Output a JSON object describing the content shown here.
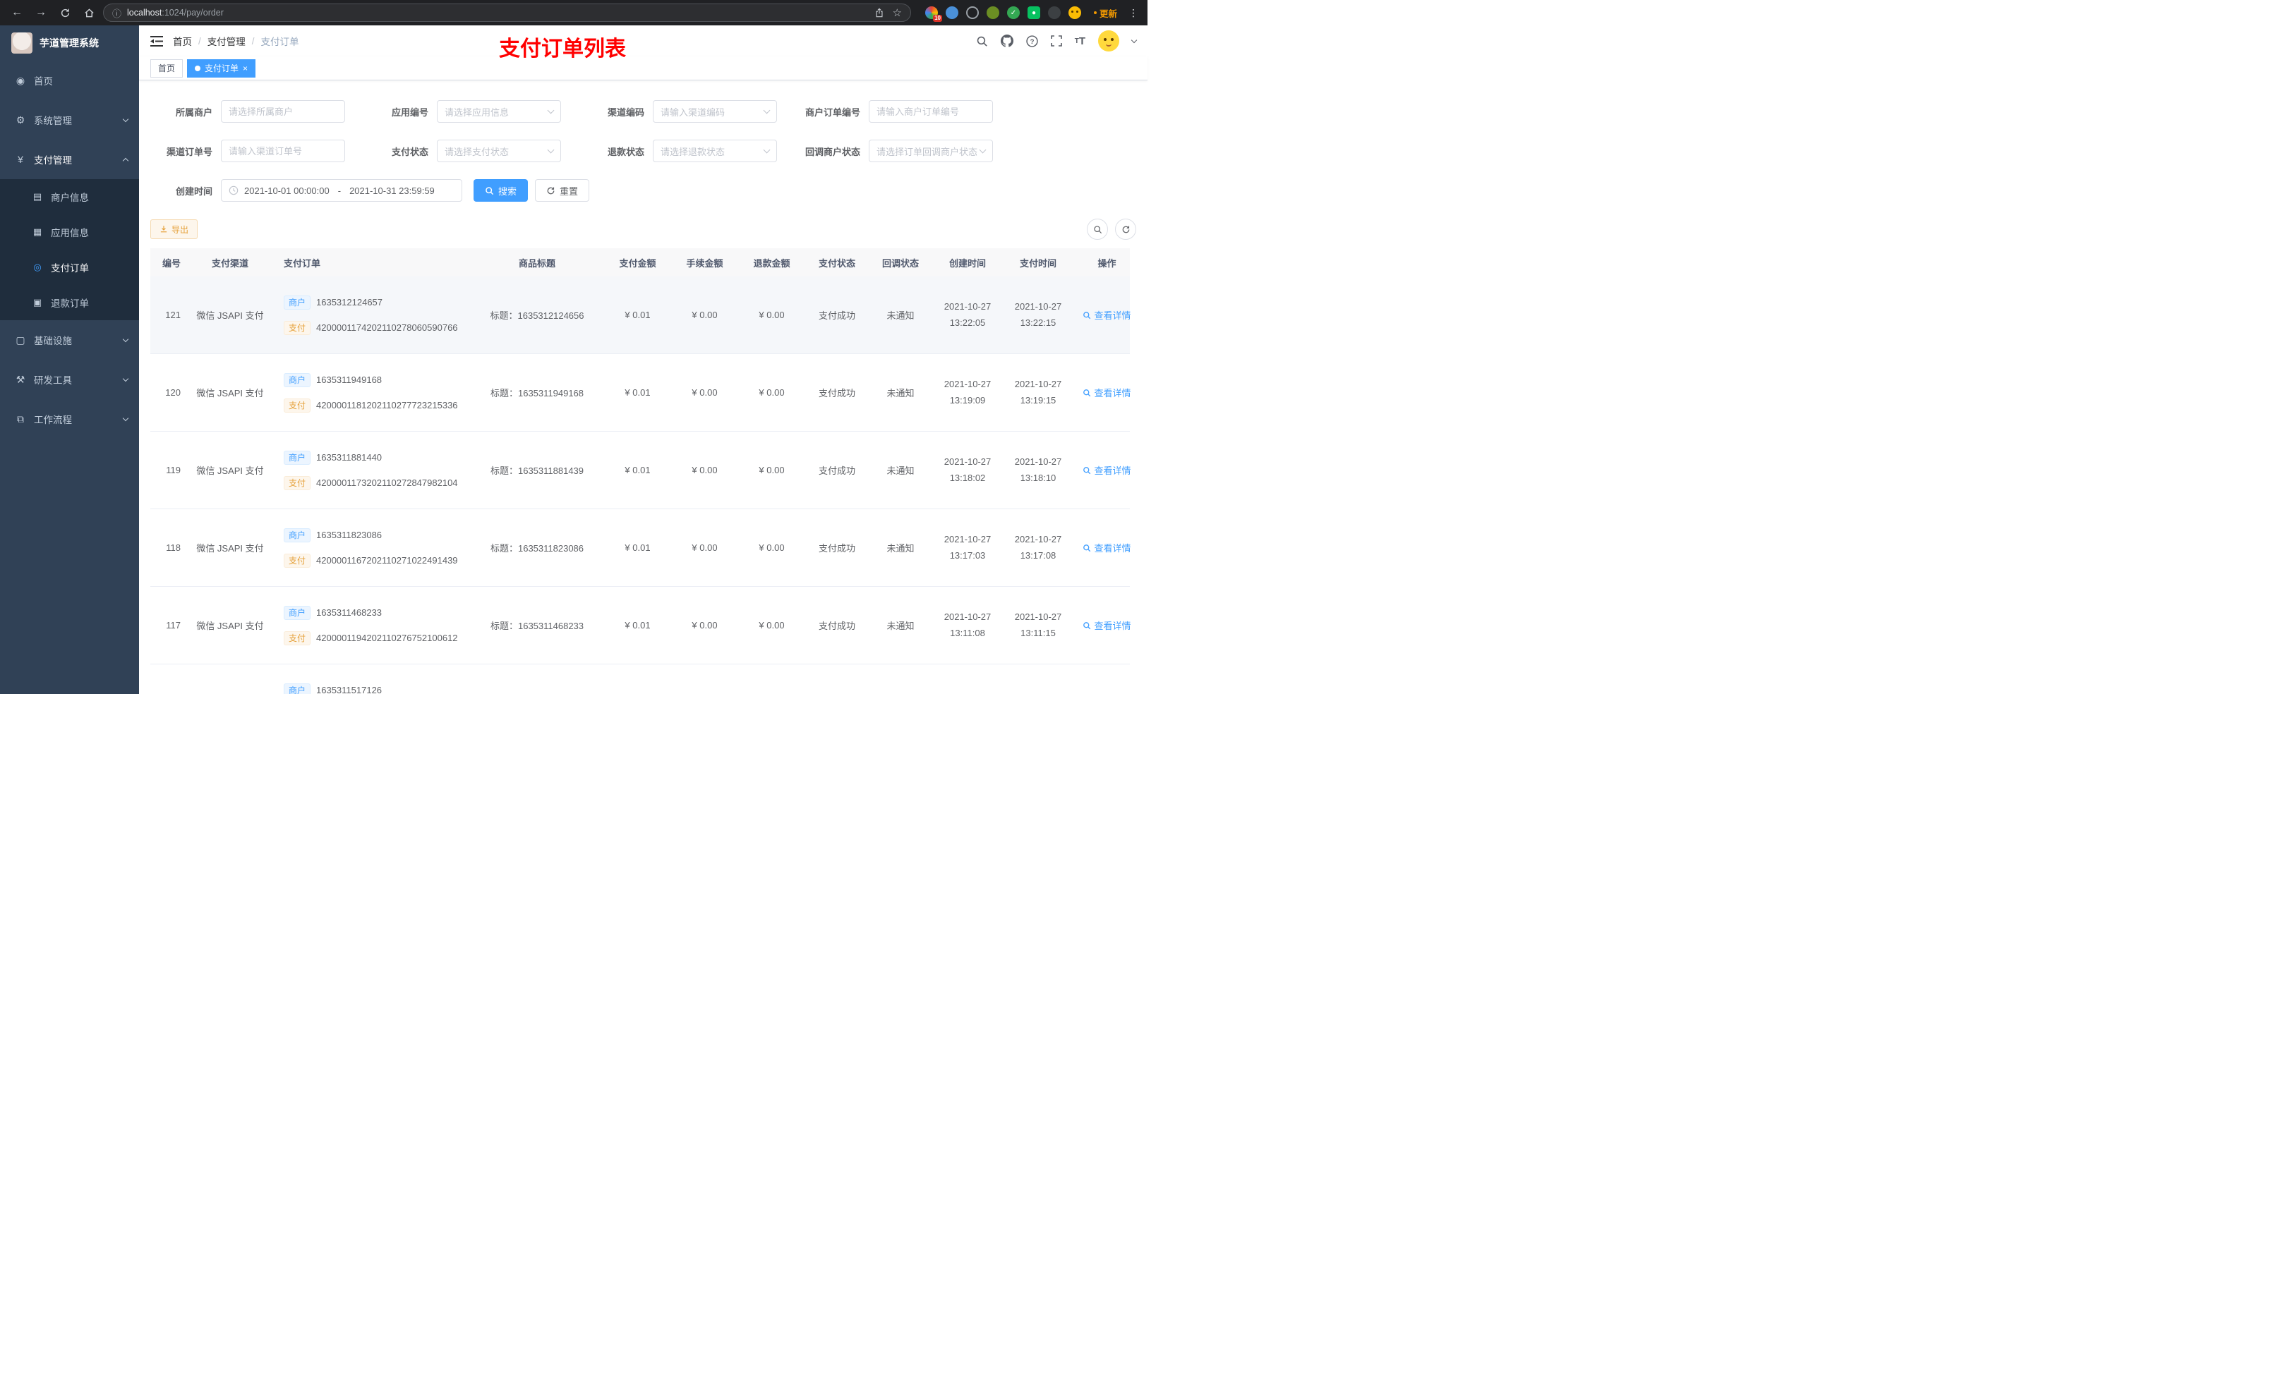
{
  "browser": {
    "url": {
      "host": "localhost",
      "path": ":1024/pay/order"
    },
    "update_label": "更新",
    "extension_badge": "10"
  },
  "sidebar": {
    "logo_title": "芋道管理系统",
    "home": "首页",
    "system": "系统管理",
    "pay": "支付管理",
    "pay_children": [
      "商户信息",
      "应用信息",
      "支付订单",
      "退款订单"
    ],
    "infra": "基础设施",
    "devtools": "研发工具",
    "workflow": "工作流程",
    "icons": {
      "home": "◉",
      "system": "⚙",
      "pay": "¥",
      "merchant": "▤",
      "app": "▦",
      "pay_order": "◎",
      "refund_order": "▣",
      "infra": "▢",
      "devtools": "⚒",
      "workflow": "⧉"
    }
  },
  "header": {
    "breadcrumb": [
      "首页",
      "支付管理",
      "支付订单"
    ],
    "annotation": "支付订单列表"
  },
  "tabs": {
    "home": "首页",
    "active": "支付订单",
    "close": "×"
  },
  "filters": {
    "merchant_label": "所属商户",
    "merchant_ph": "请选择所属商户",
    "app_label": "应用编号",
    "app_ph": "请选择应用信息",
    "channel_code_label": "渠道编码",
    "channel_code_ph": "请输入渠道编码",
    "merchant_order_label": "商户订单编号",
    "merchant_order_ph": "请输入商户订单编号",
    "channel_order_label": "渠道订单号",
    "channel_order_ph": "请输入渠道订单号",
    "pay_status_label": "支付状态",
    "pay_status_ph": "请选择支付状态",
    "refund_status_label": "退款状态",
    "refund_status_ph": "请选择退款状态",
    "notify_status_label": "回调商户状态",
    "notify_status_ph": "请选择订单回调商户状态",
    "create_time_label": "创建时间",
    "date_start": "2021-10-01 00:00:00",
    "date_separator": "-",
    "date_end": "2021-10-31 23:59:59",
    "search_label": "搜索",
    "reset_label": "重置"
  },
  "toolbar": {
    "export_label": "导出"
  },
  "table": {
    "tag_merchant": "商户",
    "tag_pay": "支付",
    "action_label": "查看详情",
    "columns": [
      "编号",
      "支付渠道",
      "支付订单",
      "商品标题",
      "支付金额",
      "手续金额",
      "退款金额",
      "支付状态",
      "回调状态",
      "创建时间",
      "支付时间",
      "操作"
    ],
    "rows": [
      {
        "id": "121",
        "channel": "微信 JSAPI 支付",
        "merchant_no": "1635312124657",
        "channel_no": "4200001174202110278060590766",
        "title": "标题：1635312124656",
        "amount": "¥ 0.01",
        "fee": "¥ 0.00",
        "refund": "¥ 0.00",
        "status": "支付成功",
        "notify": "未通知",
        "created_date": "2021-10-27",
        "created_time": "13:22:05",
        "paid_date": "2021-10-27",
        "paid_time": "13:22:15"
      },
      {
        "id": "120",
        "channel": "微信 JSAPI 支付",
        "merchant_no": "1635311949168",
        "channel_no": "4200001181202110277723215336",
        "title": "标题：1635311949168",
        "amount": "¥ 0.01",
        "fee": "¥ 0.00",
        "refund": "¥ 0.00",
        "status": "支付成功",
        "notify": "未通知",
        "created_date": "2021-10-27",
        "created_time": "13:19:09",
        "paid_date": "2021-10-27",
        "paid_time": "13:19:15"
      },
      {
        "id": "119",
        "channel": "微信 JSAPI 支付",
        "merchant_no": "1635311881440",
        "channel_no": "4200001173202110272847982104",
        "title": "标题：1635311881439",
        "amount": "¥ 0.01",
        "fee": "¥ 0.00",
        "refund": "¥ 0.00",
        "status": "支付成功",
        "notify": "未通知",
        "created_date": "2021-10-27",
        "created_time": "13:18:02",
        "paid_date": "2021-10-27",
        "paid_time": "13:18:10"
      },
      {
        "id": "118",
        "channel": "微信 JSAPI 支付",
        "merchant_no": "1635311823086",
        "channel_no": "4200001167202110271022491439",
        "title": "标题：1635311823086",
        "amount": "¥ 0.01",
        "fee": "¥ 0.00",
        "refund": "¥ 0.00",
        "status": "支付成功",
        "notify": "未通知",
        "created_date": "2021-10-27",
        "created_time": "13:17:03",
        "paid_date": "2021-10-27",
        "paid_time": "13:17:08"
      },
      {
        "id": "117",
        "channel": "微信 JSAPI 支付",
        "merchant_no": "1635311468233",
        "channel_no": "4200001194202110276752100612",
        "title": "标题：1635311468233",
        "amount": "¥ 0.01",
        "fee": "¥ 0.00",
        "refund": "¥ 0.00",
        "status": "支付成功",
        "notify": "未通知",
        "created_date": "2021-10-27",
        "created_time": "13:11:08",
        "paid_date": "2021-10-27",
        "paid_time": "13:11:15"
      },
      {
        "id": "",
        "channel": "",
        "merchant_no": "1635311517126",
        "channel_no": "",
        "title": "",
        "amount": "",
        "fee": "",
        "refund": "",
        "status": "",
        "notify": "",
        "created_date": "",
        "created_time": "",
        "paid_date": "",
        "paid_time": ""
      }
    ]
  }
}
